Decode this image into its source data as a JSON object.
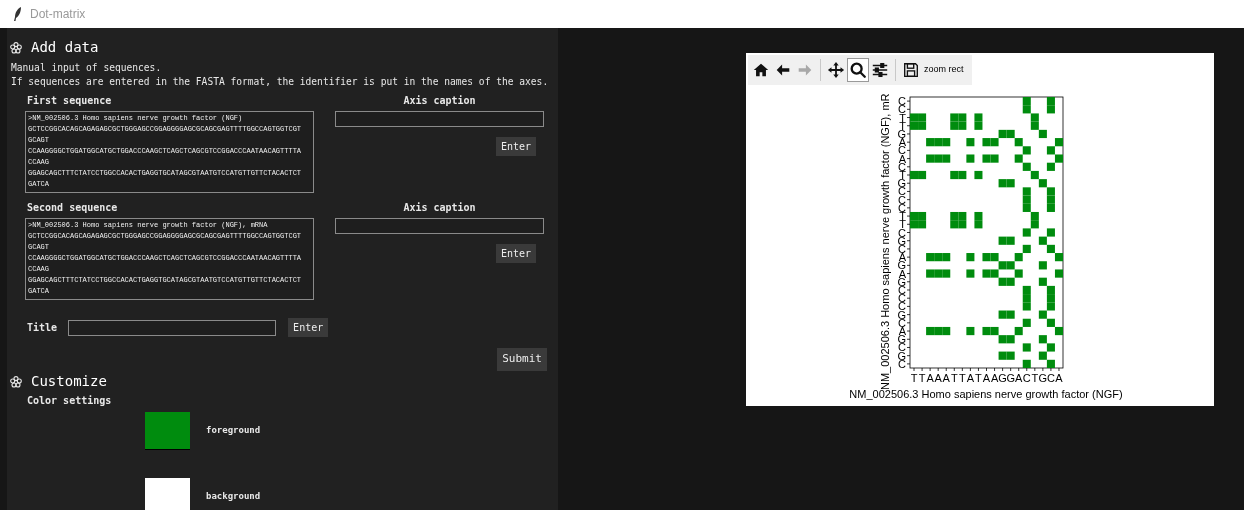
{
  "window": {
    "title": "Dot-matrix"
  },
  "add_data": {
    "heading": "Add data",
    "intro": [
      "Manual input of sequences.",
      "If sequences are entered in the FASTA format, the identifier is put in the names of the axes."
    ],
    "sequences": [
      {
        "label": "First sequence",
        "lines": [
          ">NM_002506.3 Homo sapiens nerve growth factor (NGF)",
          "GCTCCGGCACAGCAGAGAGCGCTGGGAGCCGGAGGGGAGCGCAGCGAGTTTTGGCCAGTGGTCGT",
          "GCAGT",
          "CCAAGGGGCTGGATGGCATGCTGGACCCAAGCTCAGCTCAGCGTCCGGACCCAATAACAGTTTTA",
          "CCAAG",
          "GGAGCAGCTTTCTATCCTGGCCACACTGAGGTGCATAGCGTAATGTCCATGTTGTTCTACACTCT",
          "GATCA"
        ],
        "caption_label": "Axis caption",
        "button": "Enter"
      },
      {
        "label": "Second sequence",
        "lines": [
          ">NM_002506.3 Homo sapiens nerve growth factor (NGF), mRNA",
          "GCTCCGGCACAGCAGAGAGCGCTGGGAGCCGGAGGGGAGCGCAGCGAGTTTTGGCCAGTGGTCGT",
          "GCAGT",
          "CCAAGGGGCTGGATGGCATGCTGGACCCAAGCTCAGCTCAGCGTCCGGACCCAATAACAGTTTTA",
          "CCAAG",
          "GGAGCAGCTTTCTATCCTGGCCACACTGAGGTGCATAGCGTAATGTCCATGTTGTTCTACACTCT",
          "GATCA"
        ],
        "caption_label": "Axis caption",
        "button": "Enter"
      }
    ],
    "title_field": {
      "label": "Title",
      "button": "Enter"
    },
    "submit": "Submit"
  },
  "customize": {
    "heading": "Customize",
    "subheading": "Color settings",
    "colors": [
      {
        "label": "foreground",
        "color": "#008c0e"
      },
      {
        "label": "background",
        "color": "#ffffff"
      }
    ]
  },
  "figure": {
    "toolbar": [
      {
        "kind": "home",
        "selected": false,
        "disabled": false
      },
      {
        "kind": "back",
        "selected": false,
        "disabled": false
      },
      {
        "kind": "forward",
        "selected": false,
        "disabled": true
      },
      {
        "kind": "pan",
        "selected": false,
        "disabled": false
      },
      {
        "kind": "zoom",
        "selected": true,
        "disabled": false
      },
      {
        "kind": "configure",
        "selected": false,
        "disabled": false
      },
      {
        "kind": "save",
        "selected": false,
        "disabled": false
      }
    ],
    "mode_message": "zoom rect",
    "x_sequence": "TTAAATTATAAGGACTGCA",
    "y_sequence": "CCTTGACACTGCCCTTCGCAGAGCCCGCAGCGC",
    "xlabel": "NM_002506.3 Homo sapiens nerve growth factor (NGF)",
    "ylabel": "NM_002506.3 Homo sapiens nerve growth factor (NGF), mR"
  }
}
